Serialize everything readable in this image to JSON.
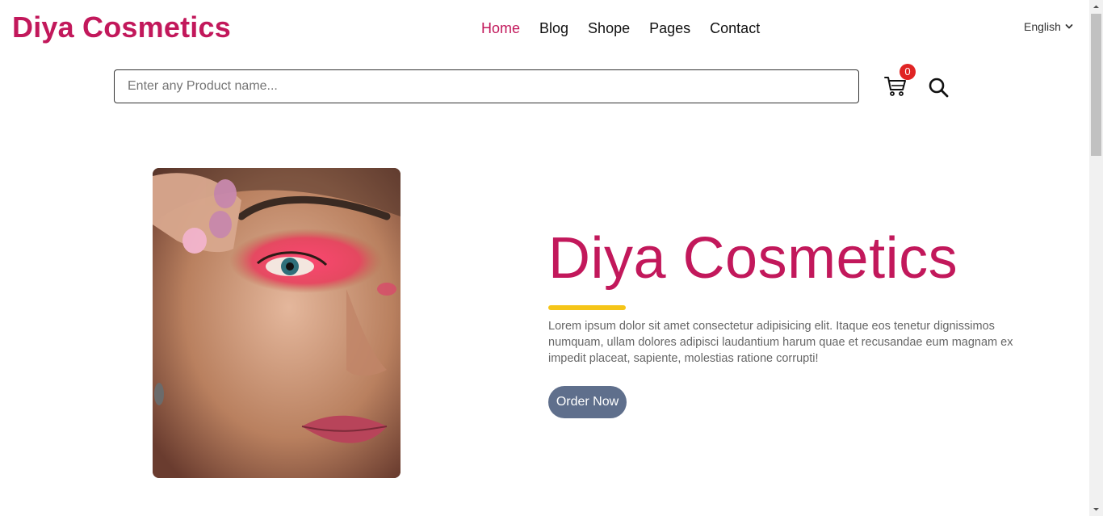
{
  "header": {
    "logo": "Diya Cosmetics",
    "nav": [
      "Home",
      "Blog",
      "Shope",
      "Pages",
      "Contact"
    ],
    "active_nav": "Home",
    "language": "English"
  },
  "search": {
    "placeholder": "Enter any Product name...",
    "value": "",
    "cart_count": "0"
  },
  "hero": {
    "title": "Diya Cosmetics",
    "text": "Lorem ipsum dolor sit amet consectetur adipisicing elit. Itaque eos tenetur dignissimos numquam, ullam dolores adipisci laudantium harum quae et recusandae eum magnam ex impedit placeat, sapiente, molestias ratione corrupti!",
    "button_label": "Order Now"
  },
  "colors": {
    "brand": "#c2185b",
    "accent_underline": "#f5c518",
    "button": "#5f6f8c",
    "badge": "#e02424"
  },
  "icons": {
    "cart": "cart-icon",
    "search": "search-icon",
    "language_dropdown": "chevron-down-icon"
  }
}
